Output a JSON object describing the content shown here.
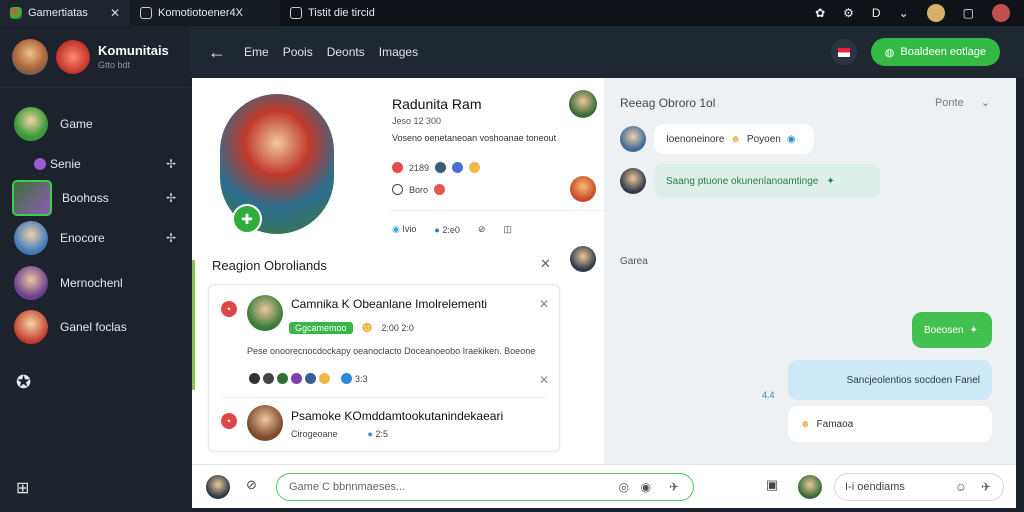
{
  "browser": {
    "tabs": [
      {
        "label": "Gamertiatas"
      },
      {
        "label": "Komotiotoener4X"
      },
      {
        "label": "Tistit die tircid"
      }
    ]
  },
  "sidebar": {
    "title": "Komunitais",
    "subtitle": "Gtto bdt",
    "items": [
      {
        "label": "Game"
      },
      {
        "label": "Senie"
      },
      {
        "label": "Boohoss"
      },
      {
        "label": "Enocore"
      },
      {
        "label": "Mernochenl"
      },
      {
        "label": "Ganel foclas"
      }
    ]
  },
  "topnav": {
    "links": [
      "Eme",
      "Poois",
      "Deonts",
      "Images"
    ],
    "action_label": "Boaldeen eotlage"
  },
  "profile": {
    "name": "Radunita Ram",
    "meta": "Jeso 12 300",
    "desc": "Voseno oenetaneoan voshoanae toneout",
    "stat1": "2189",
    "stat2": "Boro",
    "action1": "Ivio",
    "action2": "2:e0"
  },
  "section": {
    "title": "Reagion Obroliands"
  },
  "card": {
    "item1_title": "Camnika K Obeanlane Imolrelementi",
    "item1_badge": "Ggcamemoo",
    "item1_time": "2:00 2:0",
    "item1_desc": "Pese onoorecnocdockapy oeanoclacto Doceanoeobo Iraekiken. Boeone",
    "item1_count": "3:3",
    "item2_title": "Psamoke KOmddamtookutanindekaeari",
    "item2_sub": "Cirogeoane",
    "item2_time": "2:5"
  },
  "chat": {
    "header": "Reeag Obroro 1ol",
    "sort": "Ponte",
    "msg1": "Ioenoneinore",
    "msg1b": "Poyoen",
    "msg2": "Saang ptuone okunenlanoamtinge",
    "label": "Garea",
    "msg3": "Boeosen",
    "msg4": "Sancjeolentios socdoen Fanel",
    "msg4_side": "4.4",
    "msg5": "Famaoa"
  },
  "bottom": {
    "placeholder": "Game C bbnnmaeses...",
    "search_label": "I-i oendiams"
  },
  "colors": {
    "accent": "#3fbf4d",
    "dark_bg": "#1c232d"
  }
}
